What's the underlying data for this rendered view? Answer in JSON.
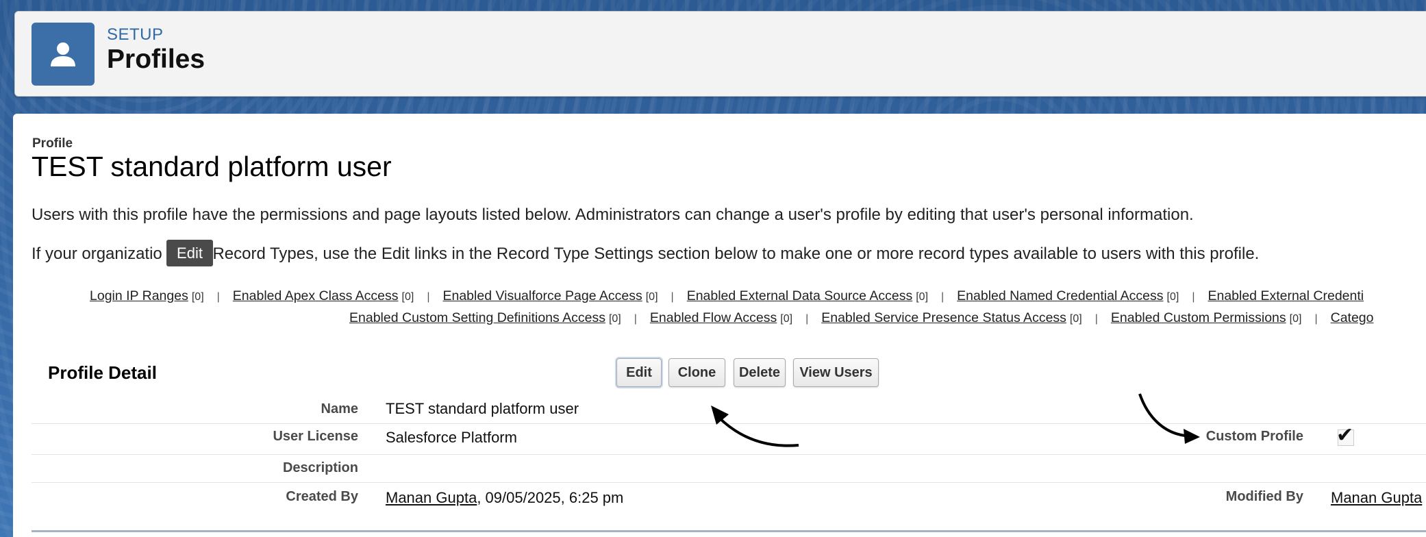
{
  "header": {
    "setup_label": "SETUP",
    "title": "Profiles",
    "icon": "user-icon"
  },
  "profile": {
    "label": "Profile",
    "name": "TEST standard platform user",
    "description_para1": "Users with this profile have the permissions and page layouts listed below. Administrators can change a user's profile by editing that user's personal information.",
    "description_para2": "If your organization uses Record Types, use the Edit links in the Record Type Settings section below to make one or more record types available to users with this profile.",
    "para2_visible": "If your organizatio",
    "para2_visible_rest": "s Record Types, use the Edit links in the Record Type Settings section below to make one or more record types available to users with this profile."
  },
  "tooltip": {
    "text": "Edit"
  },
  "related_links_row1": [
    {
      "label": "Login IP Ranges",
      "count": "[0]"
    },
    {
      "label": "Enabled Apex Class Access",
      "count": "[0]"
    },
    {
      "label": "Enabled Visualforce Page Access",
      "count": "[0]"
    },
    {
      "label": "Enabled External Data Source Access",
      "count": "[0]"
    },
    {
      "label": "Enabled Named Credential Access",
      "count": "[0]"
    },
    {
      "label": "Enabled External Credenti",
      "count": ""
    }
  ],
  "related_links_row2": [
    {
      "label": "Enabled Custom Setting Definitions Access",
      "count": "[0]"
    },
    {
      "label": "Enabled Flow Access",
      "count": "[0]"
    },
    {
      "label": "Enabled Service Presence Status Access",
      "count": "[0]"
    },
    {
      "label": "Enabled Custom Permissions",
      "count": "[0]"
    },
    {
      "label": "Catego",
      "count": ""
    }
  ],
  "separator": "|",
  "detail": {
    "title": "Profile Detail",
    "buttons": {
      "edit": "Edit",
      "clone": "Clone",
      "delete": "Delete",
      "view_users": "View Users"
    },
    "fields": {
      "name_label": "Name",
      "name_value": "TEST standard platform user",
      "license_label": "User License",
      "license_value": "Salesforce Platform",
      "custom_profile_label": "Custom Profile",
      "custom_profile_checked": true,
      "description_label": "Description",
      "description_value": "",
      "created_by_label": "Created By",
      "created_by_user": "Manan Gupta",
      "created_by_date": ", 09/05/2025, 6:25 pm",
      "modified_by_label": "Modified By",
      "modified_by_user": "Manan Gupta"
    }
  },
  "colors": {
    "background_blue": "#2e5d95",
    "header_icon": "#3c6fa8",
    "setup_text": "#2f6aa6",
    "tooltip_bg": "#4a4a4a"
  }
}
